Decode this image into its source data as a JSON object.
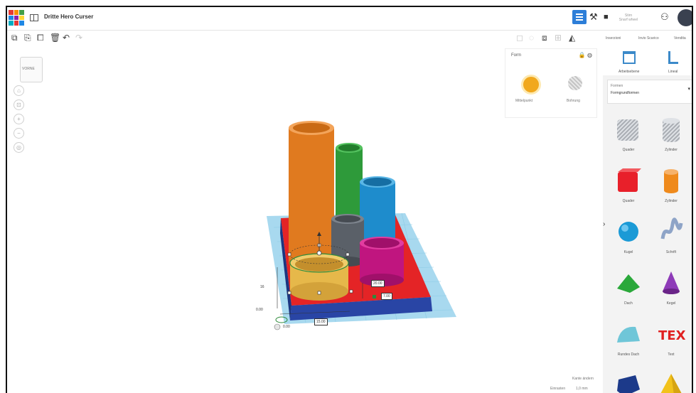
{
  "app": {
    "design_title": "Dritte Hero Curser"
  },
  "topbar": {
    "user_line1": "Stirn",
    "user_line2": "Snarf wheel"
  },
  "tabs_right": [
    "Inserzioni",
    "Invio Scarico",
    "Vendita"
  ],
  "inspector": {
    "name": "Form",
    "solid_label": "Mittelpunkt",
    "hole_label": "Bohrung"
  },
  "panel": {
    "workplane_label": "Arbeitsebene",
    "ruler_label": "Lineal",
    "dropdown_label": "Formen",
    "dropdown_value": "Formgrundformen",
    "shapes": [
      {
        "name": "Quader",
        "icon": "box-hole-icon",
        "color": "#bfc3c9"
      },
      {
        "name": "Zylinder",
        "icon": "cylinder-hole-icon",
        "color": "#bfc3c9"
      },
      {
        "name": "Quader",
        "icon": "box-icon",
        "color": "#e8202a"
      },
      {
        "name": "Zylinder",
        "icon": "cylinder-icon",
        "color": "#ef8a1c"
      },
      {
        "name": "Kugel",
        "icon": "sphere-icon",
        "color": "#1b9ad6"
      },
      {
        "name": "Schrift",
        "icon": "scribble-icon",
        "color": "#8ea4c7"
      },
      {
        "name": "Dach",
        "icon": "roof-icon",
        "color": "#2aa83a"
      },
      {
        "name": "Kegel",
        "icon": "cone-icon",
        "color": "#8e3bb8"
      },
      {
        "name": "Rundes Dach",
        "icon": "round-roof-icon",
        "color": "#6fc6d8"
      },
      {
        "name": "Text",
        "icon": "text-icon",
        "color": "#e02020"
      },
      {
        "name": "",
        "icon": "polygon-icon",
        "color": "#1c3a8a"
      },
      {
        "name": "",
        "icon": "pyramid-icon",
        "color": "#f2c21b"
      }
    ]
  },
  "viewcube_label": "VORNE",
  "dimensions": {
    "height": "16",
    "z": "0.00",
    "width": "15.00",
    "length_a": "20.00",
    "length_b": "7.00",
    "depth": "0.00"
  },
  "bottom": {
    "snap_label": "Kante ändern",
    "grid_label": "Einrasten",
    "grid_value": "1,0 mm"
  },
  "colors": {
    "orange": "#e07a1f",
    "green": "#2e9a3a",
    "blue": "#1e8ccc",
    "gray": "#5a6068",
    "magenta": "#c0157f",
    "gold": "#e6b84a",
    "red": "#e42426",
    "navy": "#2945a5",
    "workplane": "#a8d9ef"
  }
}
